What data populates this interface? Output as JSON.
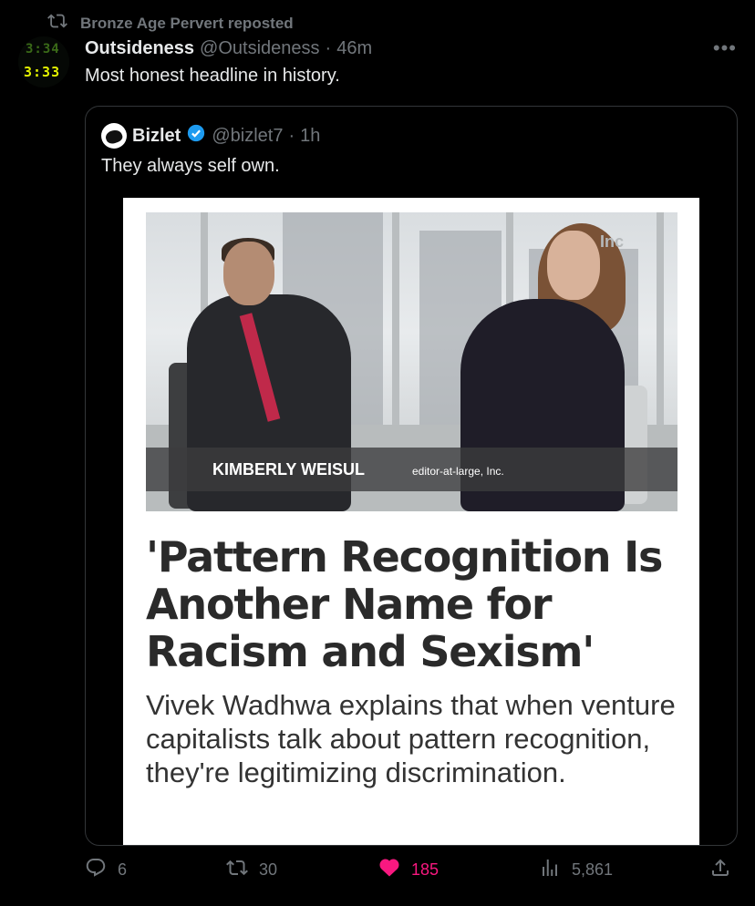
{
  "repost": {
    "label": "Bronze Age Pervert reposted"
  },
  "tweet": {
    "name": "Outsideness",
    "handle": "@Outsideness",
    "separator": "·",
    "time": "46m",
    "text": "Most honest headline in history.",
    "avatar_clock_top": "3:34",
    "avatar_clock": "3:33"
  },
  "quote": {
    "name": "Bizlet",
    "handle": "@bizlet7",
    "separator": "·",
    "time": "1h",
    "text": "They always self own.",
    "image": {
      "lower_third_name": "KIMBERLY WEISUL",
      "lower_third_role": "editor-at-large, Inc.",
      "watermark": "Inc",
      "headline": "'Pattern Recognition Is Another Name for Racism and Sexism'",
      "subheadline": "Vivek Wadhwa explains that when venture capitalists talk about pattern recognition, they're legitimizing discrimination."
    }
  },
  "actions": {
    "replies": "6",
    "reposts": "30",
    "likes": "185",
    "views": "5,861"
  },
  "colors": {
    "background": "#000000",
    "text": "#e7e9ea",
    "muted": "#71767b",
    "like": "#f91880",
    "verified": "#1d9bf0"
  }
}
